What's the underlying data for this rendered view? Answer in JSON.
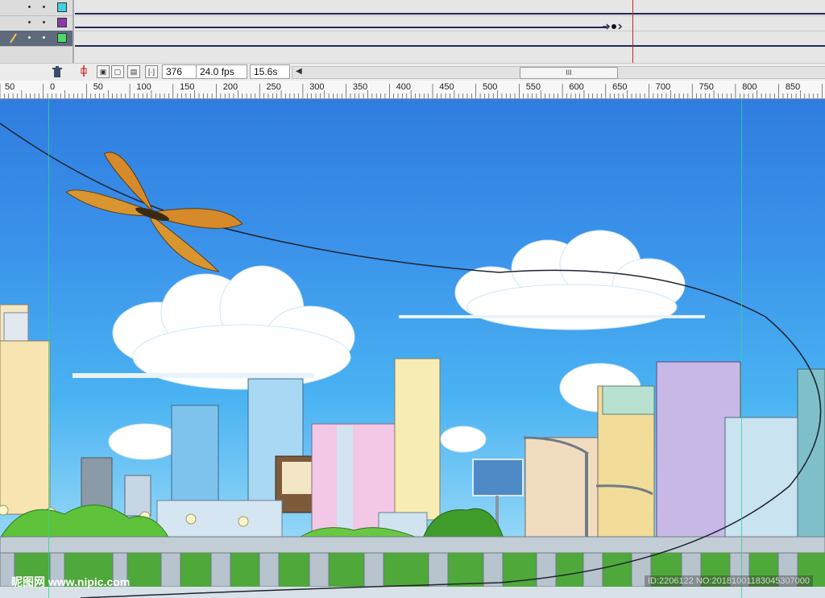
{
  "timeline": {
    "layers": [
      {
        "swatch_color": "#41d0e0"
      },
      {
        "swatch_color": "#8a3aa8"
      },
      {
        "swatch_color": "#4dd86a",
        "selected": true
      }
    ],
    "frame_number": "376",
    "frame_rate": "24.0 fps",
    "elapsed_time": "15.6s",
    "scroll_grip": "III",
    "colors": {
      "playhead": "#cc2222",
      "selected_layer": "#5f6a7d"
    }
  },
  "ruler": {
    "ticks": [
      "50",
      "0",
      "50",
      "100",
      "150",
      "200",
      "250",
      "300",
      "350",
      "400",
      "450",
      "500",
      "550",
      "600",
      "650",
      "700",
      "750",
      "800",
      "850"
    ]
  },
  "stage": {
    "sky_colors": [
      "#2f7ddf",
      "#8bd3f6"
    ]
  },
  "watermark": {
    "brand": "昵图网 www.nipic.com",
    "id": "ID:2206122 NO:20181001183045307000"
  }
}
